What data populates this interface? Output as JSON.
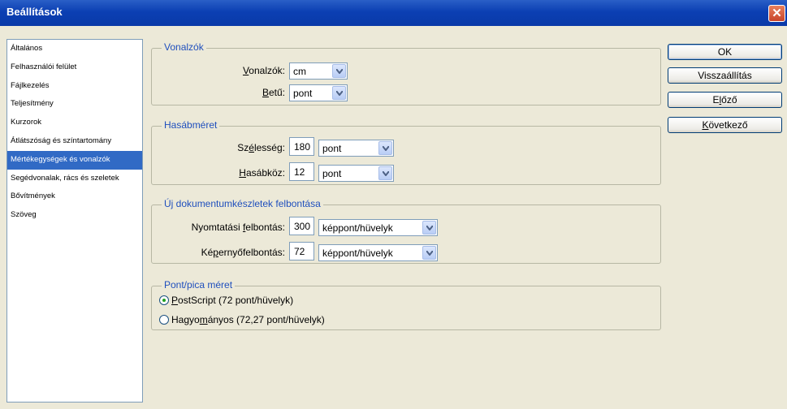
{
  "window": {
    "title": "Beállítások",
    "close_glyph": "✕"
  },
  "sidebar": {
    "items": [
      {
        "label": "Általános"
      },
      {
        "label": "Felhasználói felület"
      },
      {
        "label": "Fájlkezelés"
      },
      {
        "label": "Teljesítmény"
      },
      {
        "label": "Kurzorok"
      },
      {
        "label": "Átlátszóság és színtartomány"
      },
      {
        "label": "Mértékegységek és vonalzók",
        "selected": true
      },
      {
        "label": "Segédvonalak, rács és szeletek"
      },
      {
        "label": "Bővítmények"
      },
      {
        "label": "Szöveg"
      }
    ]
  },
  "vonalzok": {
    "title": "Vonalzók",
    "rulers": {
      "label_key": "V",
      "label_rest": "onalzók:",
      "value": "cm"
    },
    "type": {
      "label_key": "B",
      "label_rest": "etű:",
      "value": "pont"
    }
  },
  "hasab": {
    "title": "Hasábméret",
    "width": {
      "label_pre": "Sz",
      "label_key": "é",
      "label_rest": "lesség:",
      "value": "180",
      "unit": "pont"
    },
    "gutter": {
      "label_key": "H",
      "label_rest": "asábköz:",
      "value": "12",
      "unit": "pont"
    }
  },
  "preset": {
    "title": "Új dokumentumkészletek felbontása",
    "print": {
      "label_pre": "Nyomtatási ",
      "label_key": "f",
      "label_rest": "elbontás:",
      "value": "300",
      "unit": "képpont/hüvelyk"
    },
    "screen": {
      "label_pre": "Ké",
      "label_key": "p",
      "label_rest": "ernyőfelbontás:",
      "value": "72",
      "unit": "képpont/hüvelyk"
    }
  },
  "pica": {
    "title": "Pont/pica méret",
    "postscript": {
      "label_key": "P",
      "label_rest": "ostScript (72 pont/hüvelyk)",
      "checked": true
    },
    "traditional": {
      "label_pre": "Hagyo",
      "label_key": "m",
      "label_rest": "ányos (72,27 pont/hüvelyk)",
      "checked": false
    }
  },
  "buttons": {
    "ok": "OK",
    "reset": "Visszaállítás",
    "prev_pre": "E",
    "prev_key": "l",
    "prev_rest": "őző",
    "next_key": "K",
    "next_rest": "övetkező"
  },
  "colors": {
    "titlebar": "#0b3fb3",
    "selection": "#316ac5",
    "group_title": "#1f4fbd"
  }
}
